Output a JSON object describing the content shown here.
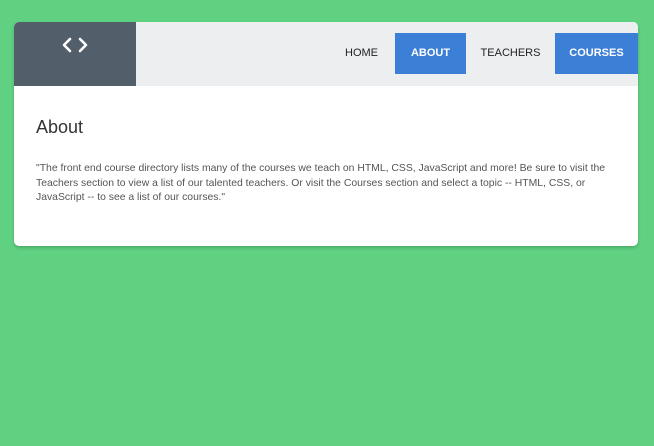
{
  "colors": {
    "page_background": "#5fd181",
    "header_background": "#edeef0",
    "logo_background": "#535e6b",
    "accent": "#3c7fd6"
  },
  "logo": {
    "icon": "code-brackets-icon"
  },
  "nav": {
    "items": [
      {
        "label": "HOME",
        "active": false
      },
      {
        "label": "ABOUT",
        "active": true
      },
      {
        "label": "TEACHERS",
        "active": false
      },
      {
        "label": "COURSES",
        "active": true
      }
    ]
  },
  "main": {
    "title": "About",
    "body": "\"The front end course directory lists many of the courses we teach on HTML, CSS, JavaScript and more! Be sure to visit the Teachers section to view a list of our talented teachers. Or visit the Courses section and select a topic -- HTML, CSS, or JavaScript -- to see a list of our courses.\""
  }
}
